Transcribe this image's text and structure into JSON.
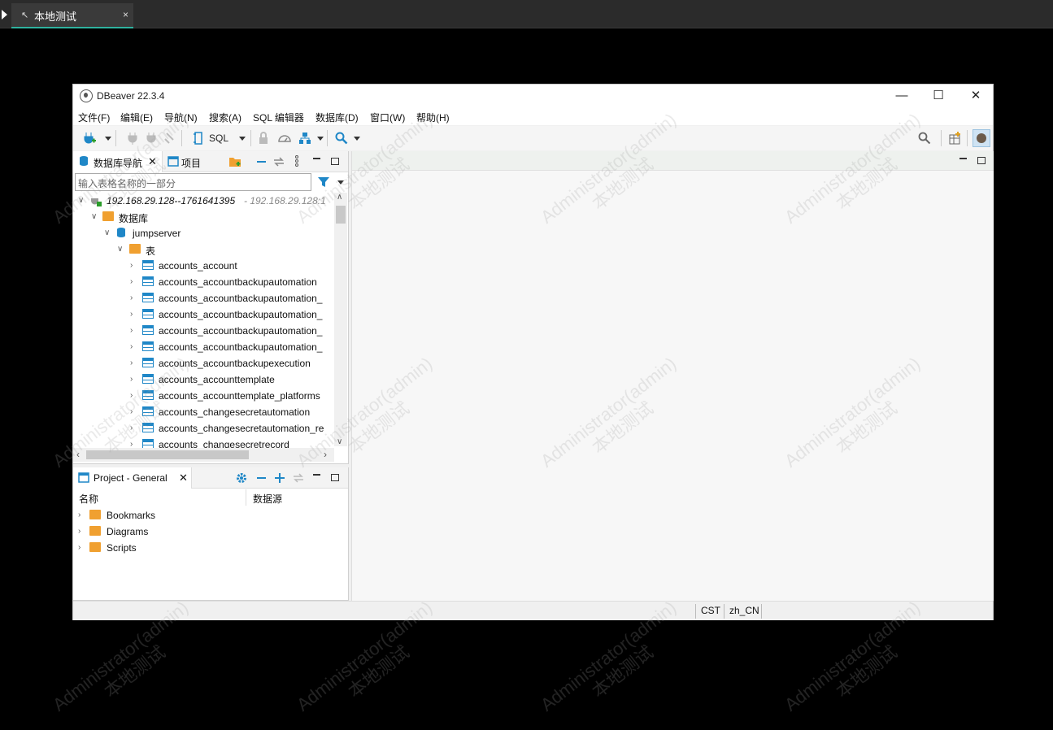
{
  "remote_tab": {
    "label": "本地测试",
    "close": "×"
  },
  "window": {
    "title": "DBeaver 22.3.4",
    "controls": {
      "minimize": "—",
      "maximize": "☐",
      "close": "✕"
    }
  },
  "menu": [
    "文件(F)",
    "编辑(E)",
    "导航(N)",
    "搜索(A)",
    "SQL 编辑器",
    "数据库(D)",
    "窗口(W)",
    "帮助(H)"
  ],
  "toolbar": {
    "sql_label": "SQL"
  },
  "navigator": {
    "tab_label": "数据库导航",
    "project_tab_label": "项目",
    "filter_placeholder": "输入表格名称的一部分",
    "connection": "192.168.29.128--1761641395",
    "connection_suffix": " - 192.168.29.128:1",
    "databases_label": "数据库",
    "schema": "jumpserver",
    "tables_label": "表",
    "tables": [
      "accounts_account",
      "accounts_accountbackupautomation",
      "accounts_accountbackupautomation_",
      "accounts_accountbackupautomation_",
      "accounts_accountbackupautomation_",
      "accounts_accountbackupautomation_",
      "accounts_accountbackupexecution",
      "accounts_accounttemplate",
      "accounts_accounttemplate_platforms",
      "accounts_changesecretautomation",
      "accounts_changesecretautomation_re",
      "accounts_changesecretrecord"
    ]
  },
  "project": {
    "tab_label": "Project - General",
    "col_name": "名称",
    "col_datasource": "数据源",
    "items": [
      "Bookmarks",
      "Diagrams",
      "Scripts"
    ]
  },
  "status": {
    "timezone": "CST",
    "locale": "zh_CN"
  },
  "watermark": {
    "line1": "Administrator(admin)",
    "line2": "本地测试"
  },
  "colors": {
    "accent": "#1f87c7",
    "tab_underline": "#2fb3a0",
    "folder": "#f0a030"
  }
}
